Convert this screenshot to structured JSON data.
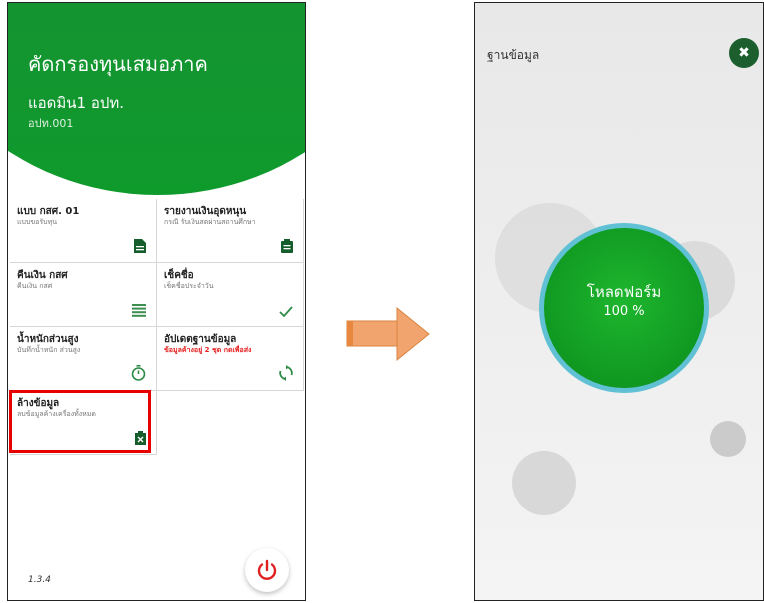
{
  "left_screen": {
    "app_title": "คัดกรองทุนเสมอภาค",
    "user_name": "แอดมิน1 อปท.",
    "user_code": "อปท.001",
    "menu": [
      {
        "title": "แบบ กสศ. 01",
        "subtitle": "แบบขอรับทุน",
        "icon": "document-icon"
      },
      {
        "title": "รายงานเงินอุดหนุน",
        "subtitle": "กรณี รับเงินสดผ่านสถานศึกษา",
        "icon": "clipboard-icon"
      },
      {
        "title": "คืนเงิน กสศ",
        "subtitle": "คืนเงิน กสศ",
        "icon": "list-icon"
      },
      {
        "title": "เช็คชื่อ",
        "subtitle": "เช็คชื่อประจำวัน",
        "icon": "check-icon"
      },
      {
        "title": "น้ำหนักส่วนสูง",
        "subtitle": "บันทึกน้ำหนัก ส่วนสูง",
        "icon": "timer-icon"
      },
      {
        "title": "อัปเดตฐานข้อมูล",
        "subtitle": "ข้อมูลค้างอยู่ 2 ชุด กดเพื่อส่ง",
        "icon": "sync-icon",
        "warning": true
      },
      {
        "title": "ล้างข้อมูล",
        "subtitle": "ลบข้อมูลค้างเครื่องทั้งหมด",
        "icon": "delete-icon"
      }
    ],
    "version": "1.3.4",
    "accent_color": "#0f8f32",
    "highlight_color": "#e60000"
  },
  "right_screen": {
    "title": "ฐานข้อมูล",
    "progress_label": "โหลดฟอร์ม",
    "progress_percent": "100 %",
    "progress_value": 1.0,
    "circle_color": "#16a42a"
  }
}
